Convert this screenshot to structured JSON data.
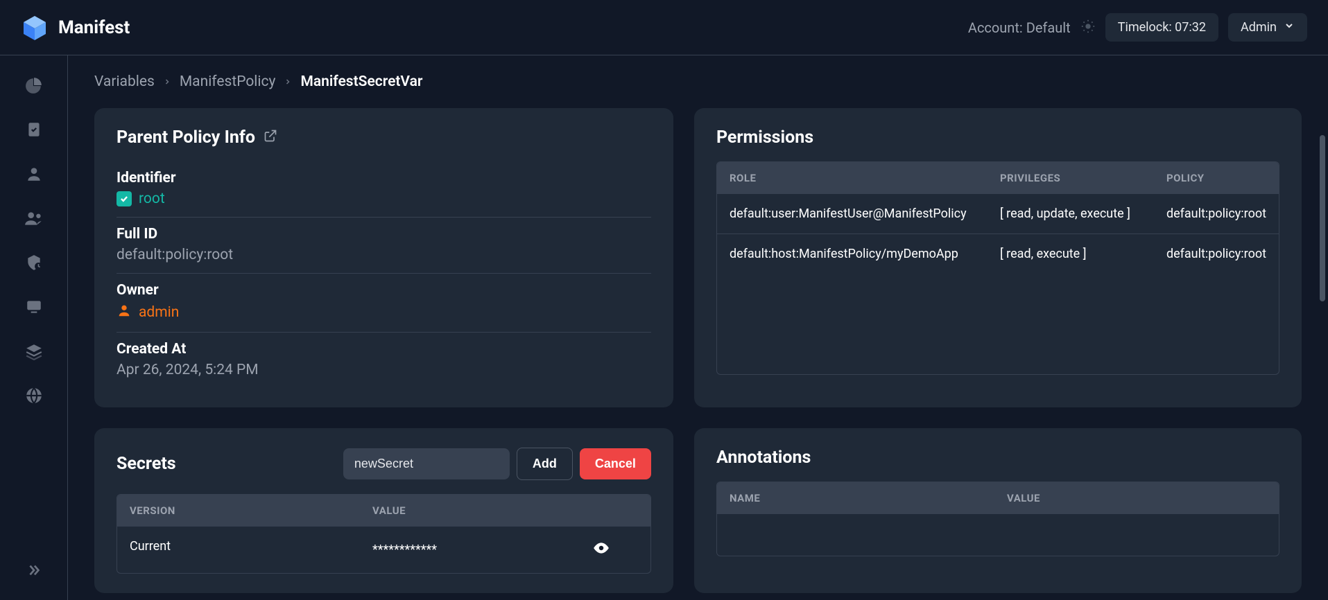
{
  "app_name": "Manifest",
  "header": {
    "account_label": "Account: Default",
    "timelock": "Timelock: 07:32",
    "user_menu": "Admin"
  },
  "breadcrumb": {
    "items": [
      "Variables",
      "ManifestPolicy",
      "ManifestSecretVar"
    ]
  },
  "parent_policy": {
    "title": "Parent Policy Info",
    "identifier_label": "Identifier",
    "identifier_value": "root",
    "full_id_label": "Full ID",
    "full_id_value": "default:policy:root",
    "owner_label": "Owner",
    "owner_value": "admin",
    "created_label": "Created At",
    "created_value": "Apr 26, 2024, 5:24 PM"
  },
  "permissions": {
    "title": "Permissions",
    "headers": {
      "role": "ROLE",
      "privileges": "PRIVILEGES",
      "policy": "POLICY"
    },
    "rows": [
      {
        "role": "default:user:ManifestUser@ManifestPolicy",
        "privileges": "[ read, update, execute ]",
        "policy": "default:policy:root"
      },
      {
        "role": "default:host:ManifestPolicy/myDemoApp",
        "privileges": "[ read, execute ]",
        "policy": "default:policy:root"
      }
    ]
  },
  "secrets": {
    "title": "Secrets",
    "input_value": "newSecret",
    "add_label": "Add",
    "cancel_label": "Cancel",
    "headers": {
      "version": "VERSION",
      "value": "VALUE"
    },
    "rows": [
      {
        "version": "Current",
        "value": "************"
      }
    ]
  },
  "annotations": {
    "title": "Annotations",
    "headers": {
      "name": "NAME",
      "value": "VALUE"
    }
  }
}
